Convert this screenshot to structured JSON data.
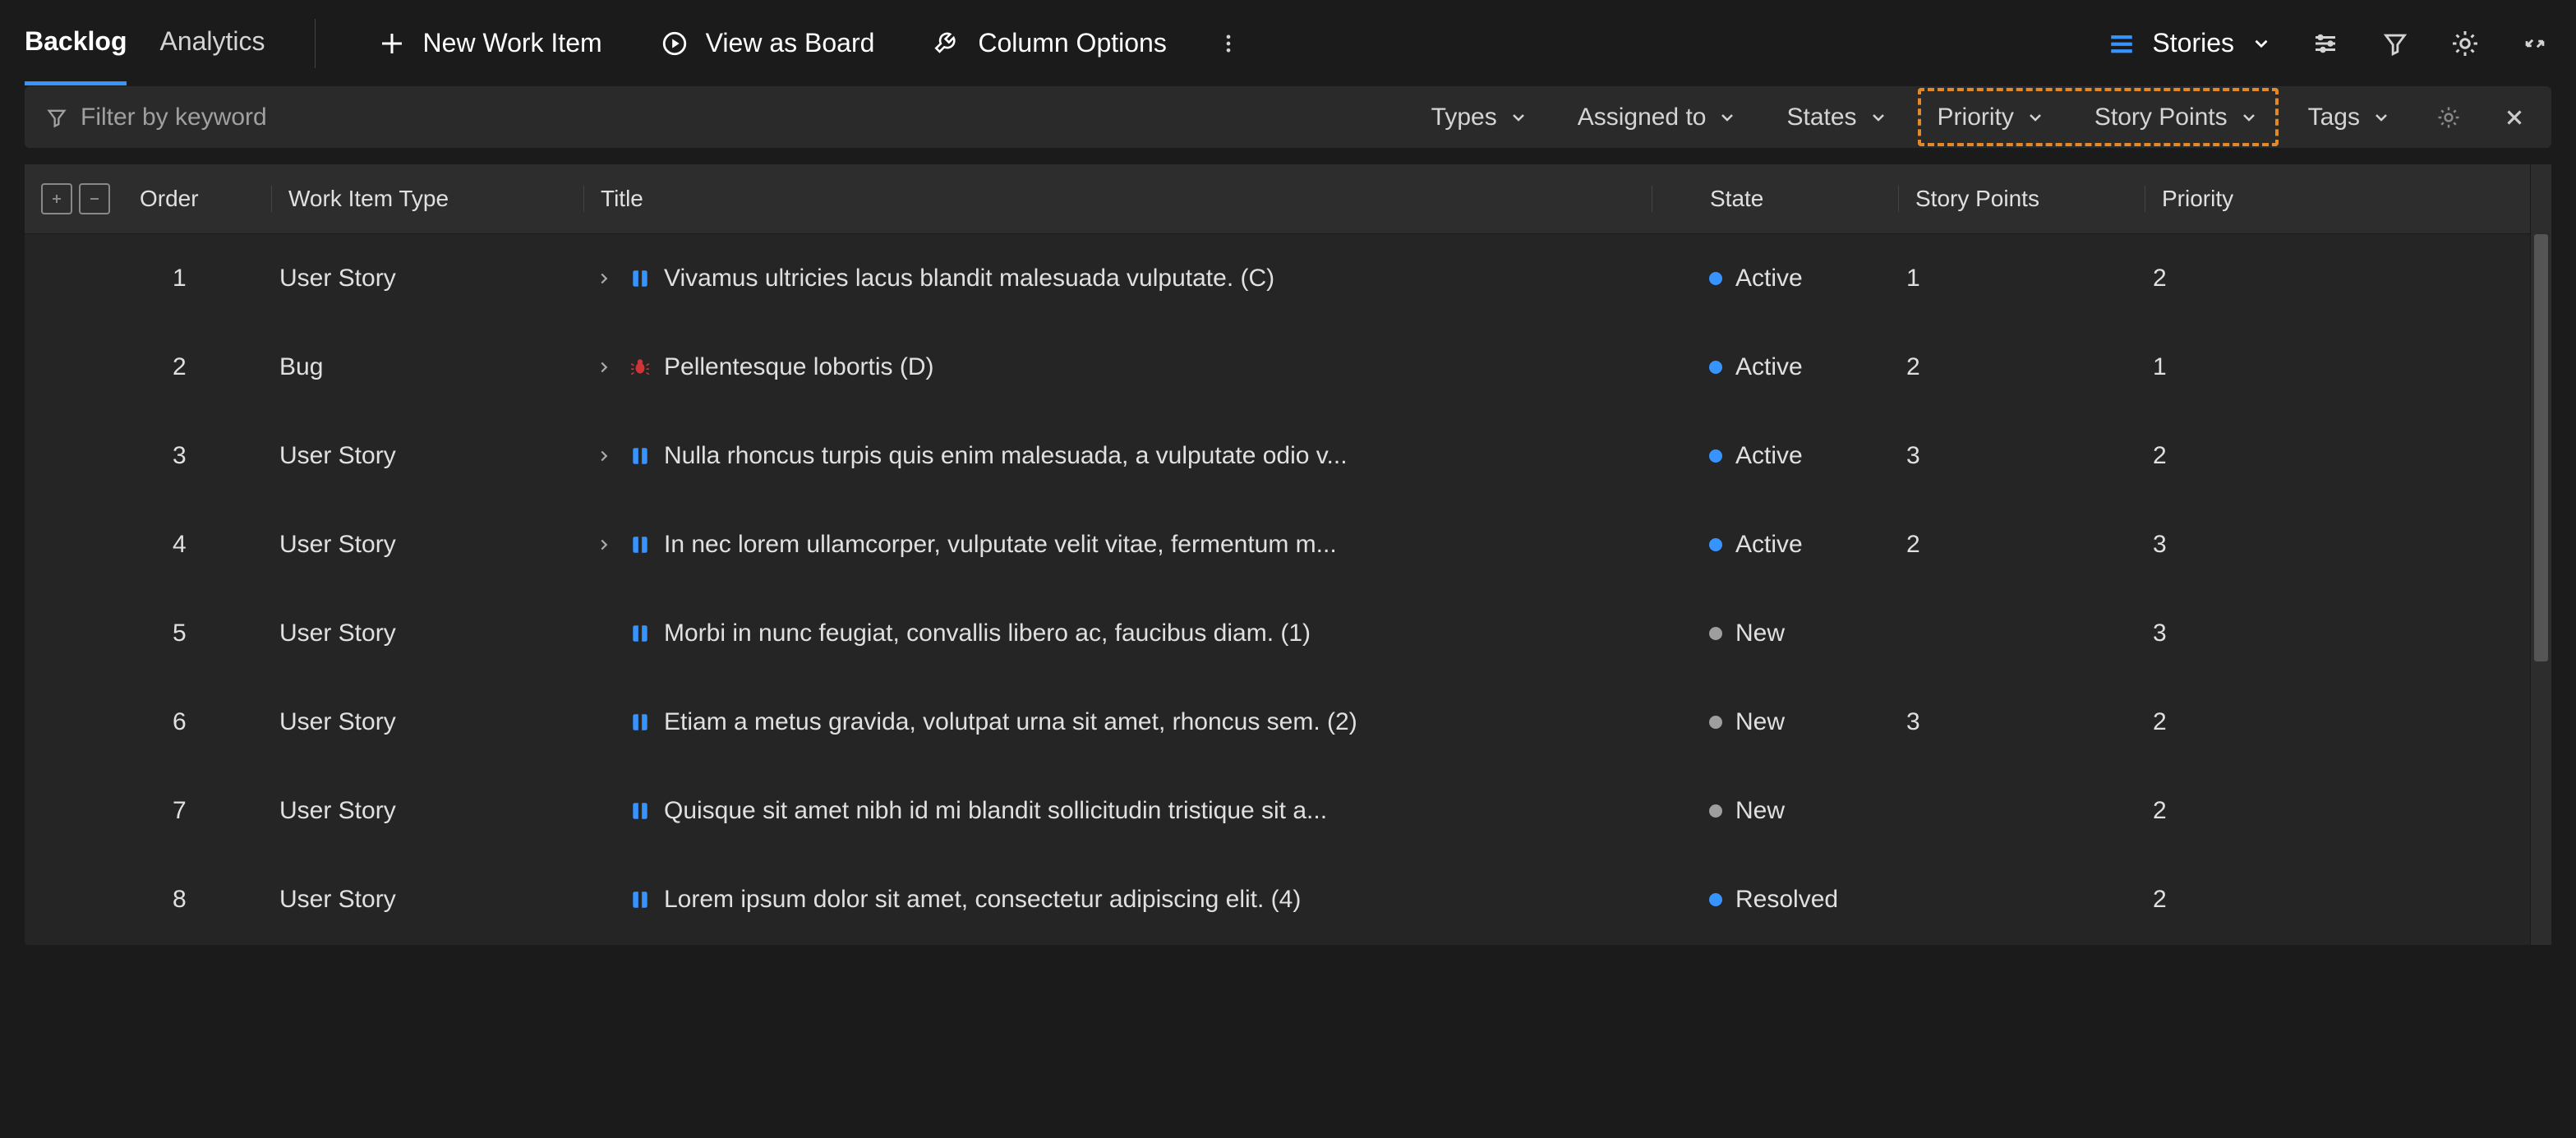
{
  "tabs": {
    "backlog": "Backlog",
    "analytics": "Analytics"
  },
  "toolbar": {
    "new_work_item": "New Work Item",
    "view_as_board": "View as Board",
    "column_options": "Column Options",
    "stories": "Stories"
  },
  "filter": {
    "placeholder": "Filter by keyword",
    "types": "Types",
    "assigned_to": "Assigned to",
    "states": "States",
    "priority": "Priority",
    "story_points": "Story Points",
    "tags": "Tags"
  },
  "columns": {
    "order": "Order",
    "work_item_type": "Work Item Type",
    "title": "Title",
    "state": "State",
    "story_points": "Story Points",
    "priority": "Priority"
  },
  "rows": [
    {
      "order": "1",
      "type": "User Story",
      "icon": "story",
      "expandable": true,
      "title": "Vivamus ultricies lacus blandit malesuada vulputate. (C)",
      "state": "Active",
      "state_kind": "active",
      "story_points": "1",
      "priority": "2"
    },
    {
      "order": "2",
      "type": "Bug",
      "icon": "bug",
      "expandable": true,
      "title": "Pellentesque lobortis (D)",
      "state": "Active",
      "state_kind": "active",
      "story_points": "2",
      "priority": "1"
    },
    {
      "order": "3",
      "type": "User Story",
      "icon": "story",
      "expandable": true,
      "title": "Nulla rhoncus turpis quis enim malesuada, a vulputate odio v...",
      "state": "Active",
      "state_kind": "active",
      "story_points": "3",
      "priority": "2"
    },
    {
      "order": "4",
      "type": "User Story",
      "icon": "story",
      "expandable": true,
      "title": "In nec lorem ullamcorper, vulputate velit vitae, fermentum m...",
      "state": "Active",
      "state_kind": "active",
      "story_points": "2",
      "priority": "3"
    },
    {
      "order": "5",
      "type": "User Story",
      "icon": "story",
      "expandable": false,
      "title": "Morbi in nunc feugiat, convallis libero ac, faucibus diam. (1)",
      "state": "New",
      "state_kind": "new",
      "story_points": "",
      "priority": "3"
    },
    {
      "order": "6",
      "type": "User Story",
      "icon": "story",
      "expandable": false,
      "title": "Etiam a metus gravida, volutpat urna sit amet, rhoncus sem. (2)",
      "state": "New",
      "state_kind": "new",
      "story_points": "3",
      "priority": "2"
    },
    {
      "order": "7",
      "type": "User Story",
      "icon": "story",
      "expandable": false,
      "title": "Quisque sit amet nibh id mi blandit sollicitudin tristique sit a...",
      "state": "New",
      "state_kind": "new",
      "story_points": "",
      "priority": "2"
    },
    {
      "order": "8",
      "type": "User Story",
      "icon": "story",
      "expandable": false,
      "title": "Lorem ipsum dolor sit amet, consectetur adipiscing elit. (4)",
      "state": "Resolved",
      "state_kind": "resolved",
      "story_points": "",
      "priority": "2"
    }
  ],
  "colors": {
    "accent": "#3794ff",
    "highlight": "#e08a2c",
    "bug": "#d13438"
  }
}
